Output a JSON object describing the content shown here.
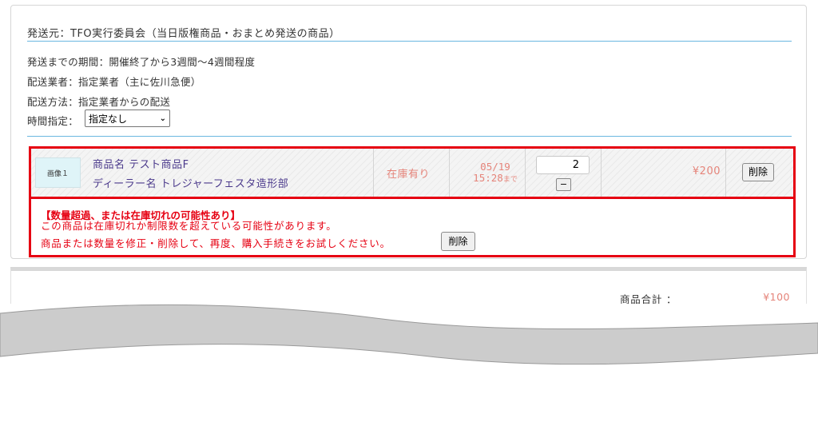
{
  "shipping": {
    "origin": "発送元：TFO実行委員会（当日版権商品・おまとめ発送の商品）",
    "period": "発送までの期間：開催終了から3週間〜4週間程度",
    "carrier": "配送業者：指定業者（主に佐川急便）",
    "method": "配送方法：指定業者からの配送",
    "time_label": "時間指定：",
    "time_selected": "指定なし"
  },
  "item": {
    "thumb_label": "画像１",
    "product_name": "商品名 テスト商品F",
    "dealer_name": "ディーラー名 トレジャーフェスタ造形部",
    "stock_status": "在庫有り",
    "deadline_date": "05/19",
    "deadline_time": "15:28",
    "deadline_suffix": "まで",
    "quantity": "2",
    "minus_label": "−",
    "price": "¥200",
    "delete_label": "削除"
  },
  "warning": {
    "title": "【数量超過、または在庫切れの可能性あり】",
    "line1": "この商品は在庫切れか制限数を超えている可能性があります。",
    "line2": "商品または数量を修正・削除して、再度、購入手続きをお試しください。",
    "delete_label": "削除"
  },
  "summary": {
    "subtotal_label": "商品合計 ：",
    "subtotal_value": "¥100"
  },
  "colors": {
    "error_red": "#e60012",
    "price_salmon": "#e5847a",
    "name_purple": "#4b3a8c",
    "rule_blue": "#6ab7e0"
  }
}
